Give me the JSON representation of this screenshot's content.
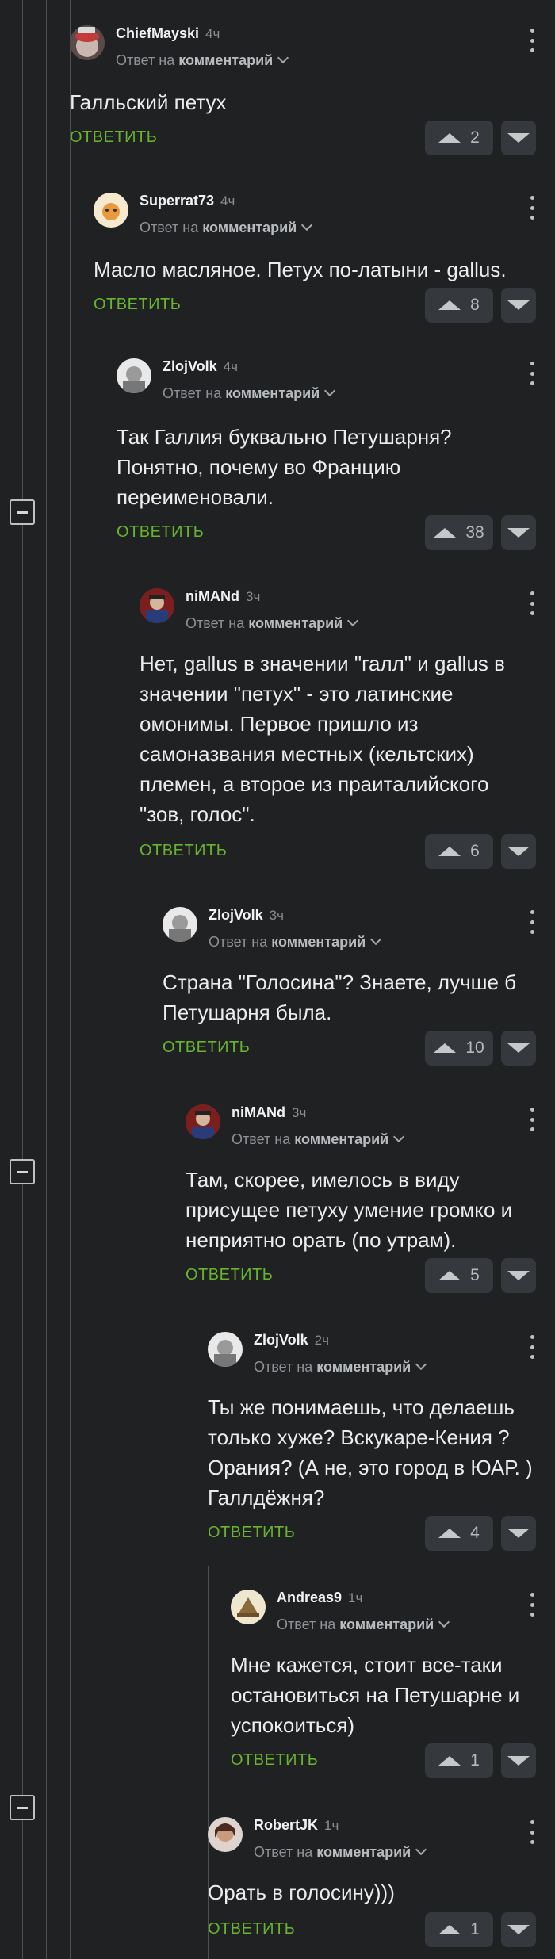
{
  "ui": {
    "reply_label": "ОТВЕТИТЬ",
    "reply_prefix": "Ответ на",
    "reply_target": "комментарий"
  },
  "comments": [
    {
      "author": "ChiefMayski",
      "time": "4ч",
      "text": "Галльский петух",
      "votes": "2"
    },
    {
      "author": "Superrat73",
      "time": "4ч",
      "text": "Масло масляное. Петух по-латыни - gallus.",
      "votes": "8"
    },
    {
      "author": "ZlojVolk",
      "time": "4ч",
      "text": "Так Галлия буквально Петушарня? Понятно, почему во Францию переименовали.",
      "votes": "38"
    },
    {
      "author": "niMANd",
      "time": "3ч",
      "text": "Нет, gallus в значении \"галл\" и gallus в значении \"петух\" - это латинские омонимы. Первое пришло из самоназвания местных (кельтских) племен, а второе из праиталийского \"зов, голос\".",
      "votes": "6"
    },
    {
      "author": "ZlojVolk",
      "time": "3ч",
      "text": "Страна \"Голосина\"? Знаете, лучше б Петушарня была.",
      "votes": "10"
    },
    {
      "author": "niMANd",
      "time": "3ч",
      "text": "Там, скорее, имелось в виду присущее петуху умение громко и неприятно орать (по утрам).",
      "votes": "5"
    },
    {
      "author": "ZlojVolk",
      "time": "2ч",
      "text": "Ты же понимаешь, что делаешь только хуже? Вскукаре-Кения ? Орания? (А не, это город в ЮАР. ) Галлдёжня?",
      "votes": "4"
    },
    {
      "author": "Andreas9",
      "time": "1ч",
      "text": "Мне кажется, стоит все-таки остановиться на Петушарне и успокоиться)",
      "votes": "1"
    },
    {
      "author": "RobertJK",
      "time": "1ч",
      "text": "Орать в голосину)))",
      "votes": "1"
    }
  ],
  "colors": {
    "background": "#1f2123",
    "reply_green": "#69b42e",
    "button_bg": "#35383c"
  },
  "icons": [
    "avatar",
    "more-vertical-icon",
    "chevron-down-icon",
    "upvote-icon",
    "downvote-icon",
    "collapse-icon"
  ]
}
